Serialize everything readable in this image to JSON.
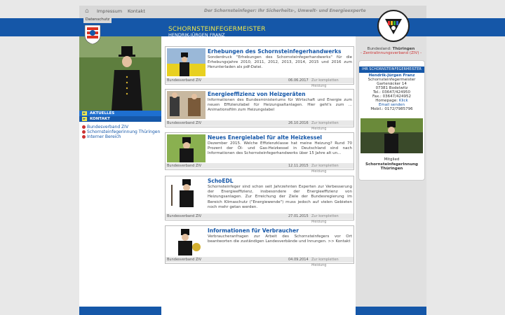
{
  "nav": {
    "impressum": "Impressum",
    "kontakt": "Kontakt",
    "datenschutz": "Datenschutz",
    "slogan": "Der Schornsteinfeger: Ihr Sicherheits-, Umwelt- und Energieexperte"
  },
  "header": {
    "title": "SCHORNSTEINFEGERMEISTER",
    "subtitle": "HENDRIK-JÜRGEN FRANZ"
  },
  "sidebar": {
    "aktuelles": "AKTUELLES",
    "kontakt": "KONTAKT",
    "links": [
      "Bundesverband ZIV",
      "Schornsteinfegerinnung Thüringen",
      "Interner Bereich"
    ]
  },
  "articles": [
    {
      "title": "Erhebungen des Schornsteinfegerhandwerks",
      "text": "Sonderdruck \"Erhebungen des Schornsteinfegerhandwerks\" für die Erhebungsjahre 2010, 2011, 2012, 2013, 2014, 2015 und 2016 zum Herunterladen als pdf-Datei.",
      "source": "Bundesverband ZIV",
      "date": "06.06.2017",
      "more": "Zur kompletten Meldung"
    },
    {
      "title": "Energieeffizienz von Heizgeräten",
      "text": "Informationen des Bundesministeriums für Wirtschaft und Energie zum neuen Effizienzlabel für Heizungsaltanlagen. Hier geht's zum ... Animationsfilm zum Heizungslabel",
      "source": "Bundesverband ZIV",
      "date": "26.10.2016",
      "more": "Zur kompletten Meldung"
    },
    {
      "title": "Neues Energielabel für alte Heizkessel",
      "text": "Dezember 2015. Welche Effizienzklasse hat meine Heizung? Rund 70 Prozent der Öl- und Gas-Heizkessel in Deutschland sind nach Informationen des Schornsteinfegerhandwerks über 15 Jahre alt un...",
      "source": "Bundesverband ZIV",
      "date": "12.11.2015",
      "more": "Zur kompletten Meldung"
    },
    {
      "title": "SchoEDL",
      "text": "Schornsteinfeger sind schon seit Jahrzehnten Experten zur Verbesserung der Energieeffizienz, insbesondere der Energieeffizienz von Heizungsanlagen. Zur Erreichung der Ziele der Bundesregierung im Bereich Klimaschutz (\"Energiewende\") muss jedoch auf vielen Gebieten noch mehr getan werden.",
      "source": "Bundesverband ZIV",
      "date": "27.01.2015",
      "more": "Zur kompletten Meldung"
    },
    {
      "title": "Informationen für Verbraucher",
      "text": "Verbraucheranfragen zur Arbeit des Schornsteinfegers vor Ort beantworten die zuständigen Landesverbände und Innungen. >> Kontakt",
      "source": "Bundesverband ZIV",
      "date": "04.09.2014",
      "more": "Zur kompletten Meldung"
    }
  ],
  "right": {
    "bundesland_label": "Bundesland:",
    "bundesland": "Thüringen",
    "zentral": "- Zentralinnungsverband (ZIV) -",
    "card_header": "IHR SCHORNSTEINFEGERMEISTER",
    "name": "Hendrik-Jürgen Franz",
    "role": "Schornsteinfegermeister",
    "street": "Gartenäcker 14",
    "city": "07381 Bodelwitz",
    "tel": "Tel.: 03647/424950",
    "fax": "Fax.: 03647/424952",
    "homepage_label": "Homepage:",
    "homepage_link": "Klick",
    "email": "Email senden",
    "mobil": "Mobil.: 0172/7985796",
    "member": "Mitglied",
    "innung": "Schornsteinfegerinnung Thüringen"
  }
}
